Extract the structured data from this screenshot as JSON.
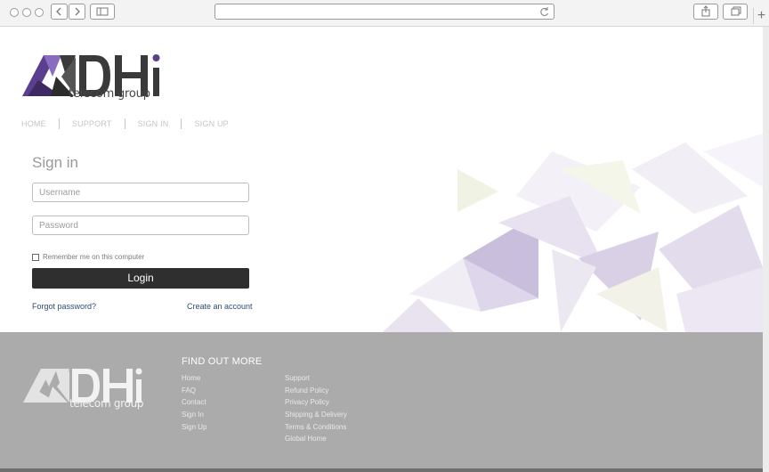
{
  "brand": {
    "logo_text": "DHi",
    "tagline": "telecom group"
  },
  "nav": {
    "items": [
      "HOME",
      "SUPPORT",
      "SIGN IN",
      "SIGN UP"
    ]
  },
  "signin": {
    "title": "Sign in",
    "username_placeholder": "Username",
    "password_placeholder": "Password",
    "remember_label": "Remember me on this computer",
    "login_label": "Login",
    "forgot_label": "Forgot password?",
    "create_label": "Create an account"
  },
  "footer": {
    "heading": "FIND OUT MORE",
    "col1": [
      "Home",
      "FAQ",
      "Contact",
      "Sign In",
      "Sign Up"
    ],
    "col2": [
      "Support",
      "Refund Policy",
      "Privacy Policy",
      "Shipping & Delivery",
      "Terms & Conditions",
      "Global Home"
    ]
  },
  "browser": {
    "new_tab_label": "+"
  },
  "colors": {
    "brand_purple": "#5b3f8e",
    "login_button": "#2f2f2f",
    "link_blue": "#2b4d7a",
    "footer_gray": "#ababab"
  }
}
